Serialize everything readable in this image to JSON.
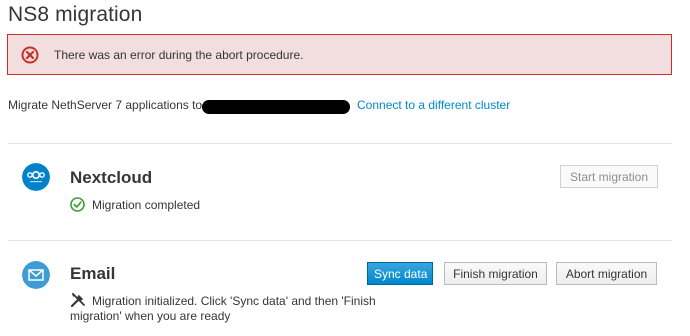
{
  "page": {
    "title": "NS8 migration"
  },
  "alert": {
    "text": "There was an error during the abort procedure.",
    "color": "#c9302c"
  },
  "intro": {
    "text": "Migrate NethServer 7 applications to",
    "redacted": "",
    "link": "Connect to a different cluster"
  },
  "apps": [
    {
      "name": "Nextcloud",
      "icon": "nextcloud-icon",
      "status_icon": "check-circle-icon",
      "status": "Migration completed",
      "start_button": "Start migration"
    },
    {
      "name": "Email",
      "icon": "email-icon",
      "status_icon": "tools-icon",
      "status_line1": "Migration initialized. Click 'Sync data' and then 'Finish",
      "status_line2": "migration' when you are ready",
      "sync_button": "Sync data",
      "finish_button": "Finish migration",
      "abort_button": "Abort migration"
    }
  ],
  "colors": {
    "accent": "#0088ce",
    "success": "#3f9c35",
    "error": "#c9302c"
  }
}
